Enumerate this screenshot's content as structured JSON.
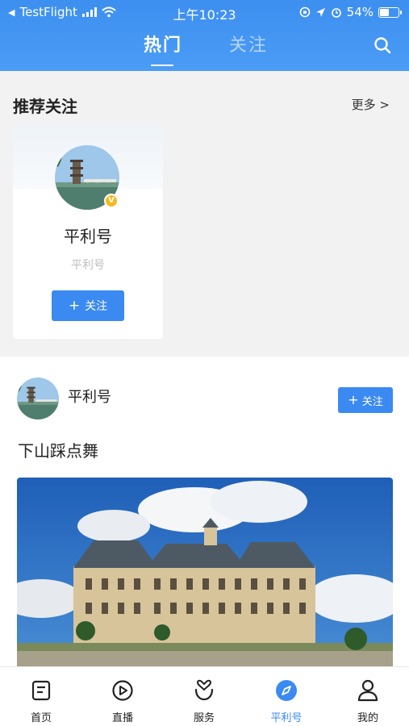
{
  "status_bar": {
    "back_app": "TestFlight",
    "time": "上午10:23",
    "battery": "54%",
    "battery_level": 0.54
  },
  "top_tabs": {
    "hot": "热门",
    "follow": "关注",
    "active": "hot"
  },
  "recommend": {
    "title": "推荐关注",
    "more": "更多 >",
    "card": {
      "name": "平利号",
      "subtitle": "平利号",
      "follow_label": "关注",
      "badge": "V"
    }
  },
  "feed": {
    "author": "平利号",
    "follow_label": "关注",
    "post_title": "下山踩点舞"
  },
  "tabbar": {
    "items": [
      {
        "label": "首页",
        "icon": "home-doc-icon"
      },
      {
        "label": "直播",
        "icon": "play-circle-icon"
      },
      {
        "label": "服务",
        "icon": "heart-hand-icon"
      },
      {
        "label": "平利号",
        "icon": "compass-icon"
      },
      {
        "label": "我的",
        "icon": "user-icon"
      }
    ],
    "active_index": 3
  },
  "colors": {
    "header_blue": "#4196f2",
    "accent": "#3a8af2",
    "badge_yellow": "#f5b820"
  }
}
